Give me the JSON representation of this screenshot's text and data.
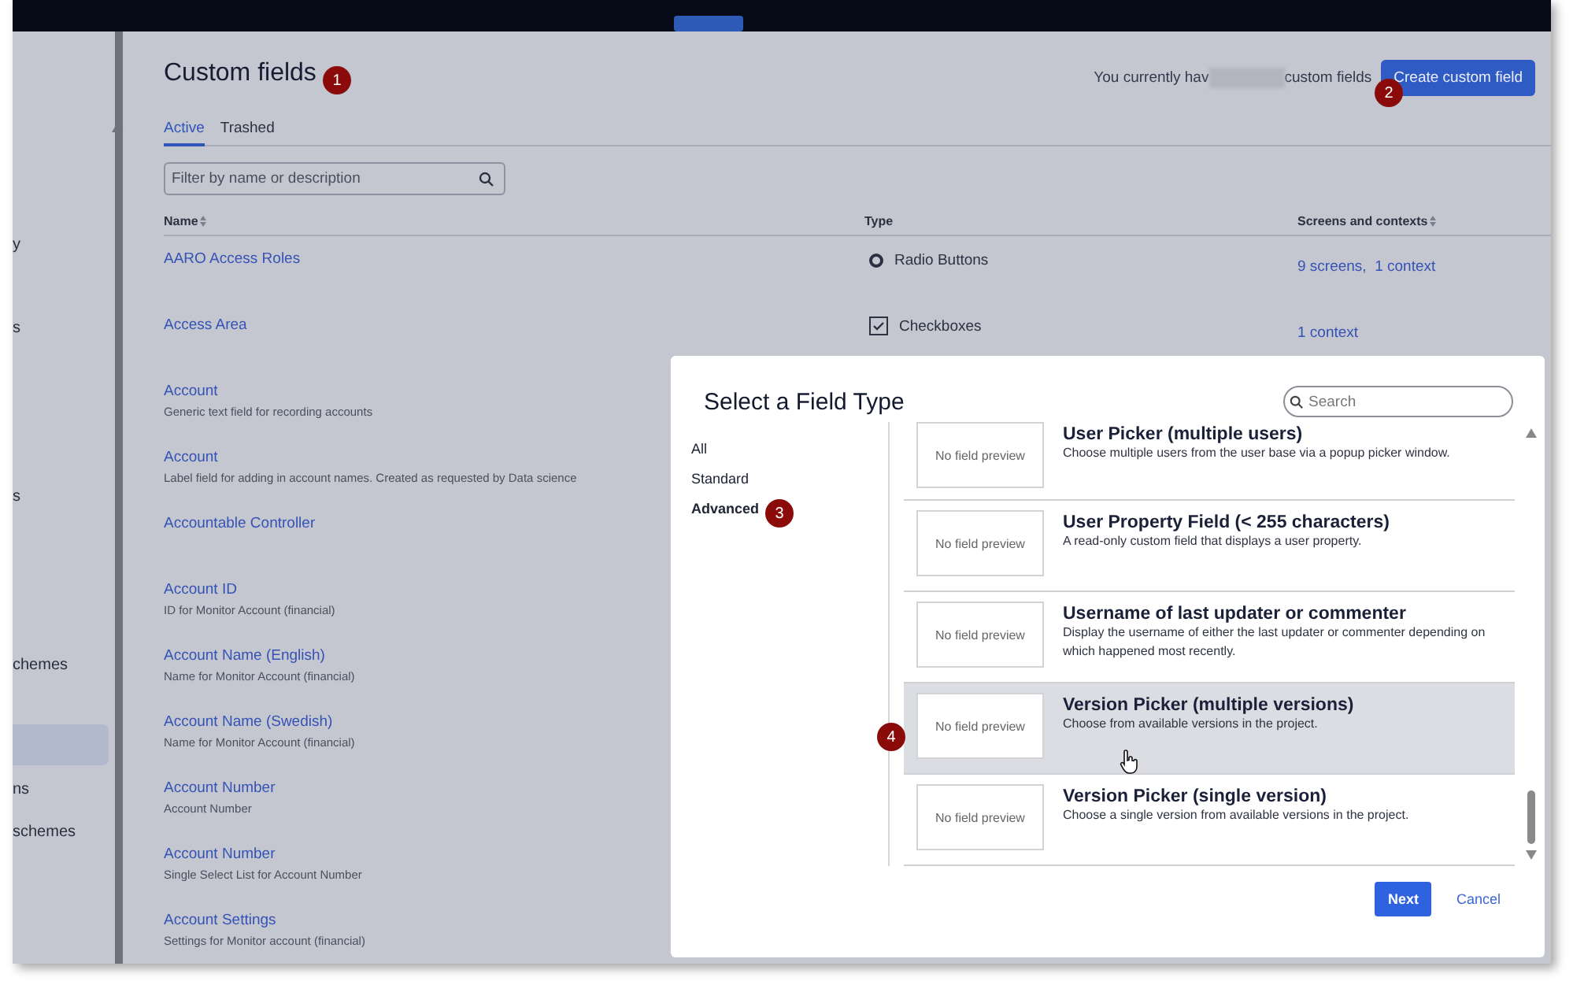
{
  "sidebar": {
    "items": [
      {
        "label": "y",
        "selected": false
      },
      {
        "label": "s",
        "selected": false
      },
      {
        "label": "s",
        "selected": false
      },
      {
        "label": "chemes",
        "selected": false
      },
      {
        "selected": true
      },
      {
        "label": "ns",
        "selected": false
      },
      {
        "label": "schemes",
        "selected": false
      }
    ]
  },
  "header": {
    "title": "Custom fields",
    "count_prefix": "You currently hav",
    "count_suffix": "custom fields",
    "create_button": "Create custom field"
  },
  "tabs": [
    {
      "label": "Active",
      "selected": true
    },
    {
      "label": "Trashed",
      "selected": false
    }
  ],
  "filter": {
    "placeholder": "Filter by name or description"
  },
  "table": {
    "columns": [
      {
        "label": "Name",
        "sortable": true
      },
      {
        "label": "Type",
        "sortable": false
      },
      {
        "label": "Screens and contexts",
        "sortable": true
      }
    ],
    "rows": [
      {
        "name": "AARO Access Roles",
        "type": {
          "kind": "radio",
          "label": "Radio Buttons"
        },
        "contexts": "9 screens,  1 context"
      },
      {
        "name": "Access Area",
        "type": {
          "kind": "checkbox",
          "label": "Checkboxes"
        },
        "contexts": "1 context"
      },
      {
        "name": "Account",
        "description": "Generic text field for recording accounts"
      },
      {
        "name": "Account",
        "description": "Label field for adding in account names. Created as requested by Data science"
      },
      {
        "name": "Accountable Controller"
      },
      {
        "name": "Account ID",
        "description": "ID for Monitor Account (financial)"
      },
      {
        "name": "Account Name (English)",
        "description": "Name for Monitor Account (financial)"
      },
      {
        "name": "Account Name (Swedish)",
        "description": "Name for Monitor Account (financial)"
      },
      {
        "name": "Account Number",
        "description": "Account Number"
      },
      {
        "name": "Account Number",
        "description": "Single Select List for Account Number"
      },
      {
        "name": "Account Settings",
        "description": "Settings for Monitor account (financial)"
      }
    ]
  },
  "modal": {
    "title": "Select a Field Type",
    "search": {
      "placeholder": "Search"
    },
    "categories": [
      {
        "label": "All",
        "selected": false
      },
      {
        "label": "Standard",
        "selected": false
      },
      {
        "label": "Advanced",
        "selected": true
      }
    ],
    "field_types": [
      {
        "preview": "No field preview",
        "name": "User Picker (multiple users)",
        "description": "Choose multiple users from the user base via a popup picker window.",
        "hovered": false
      },
      {
        "preview": "No field preview",
        "name": "User Property Field (< 255 characters)",
        "description": "A read-only custom field that displays a user property.",
        "hovered": false
      },
      {
        "preview": "No field preview",
        "name": "Username of last updater or commenter",
        "description": "Display the username of either the last updater or commenter depending on which happened most recently.",
        "hovered": false
      },
      {
        "preview": "No field preview",
        "name": "Version Picker (multiple versions)",
        "description": "Choose from available versions in the project.",
        "hovered": true
      },
      {
        "preview": "No field preview",
        "name": "Version Picker (single version)",
        "description": "Choose a single version from available versions in the project.",
        "hovered": false
      }
    ],
    "next_button": "Next",
    "cancel_link": "Cancel"
  },
  "annotations": [
    {
      "label": "1"
    },
    {
      "label": "2"
    },
    {
      "label": "3"
    },
    {
      "label": "4"
    }
  ]
}
